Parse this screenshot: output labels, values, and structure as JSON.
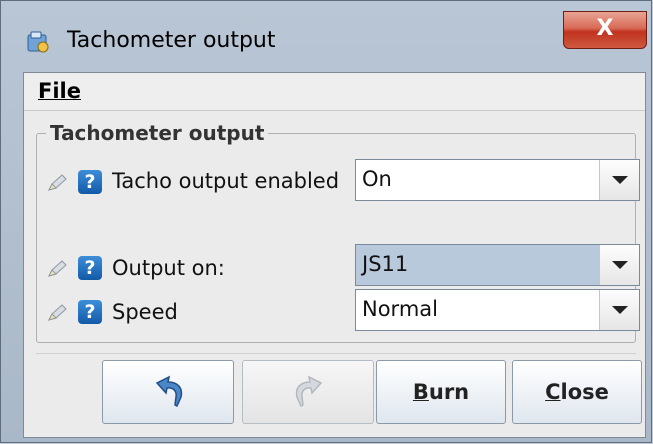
{
  "window": {
    "title": "Tachometer output",
    "close_glyph": "X"
  },
  "menubar": {
    "file_label": "File"
  },
  "group": {
    "title": "Tachometer output",
    "rows": [
      {
        "icon_edit": "pencil-icon",
        "icon_help": "help-icon",
        "help_glyph": "?",
        "label": "Tacho output enabled",
        "value": "On"
      },
      {
        "icon_edit": "pencil-icon",
        "icon_help": "help-icon",
        "help_glyph": "?",
        "label": "Output on:",
        "value": "JS11"
      },
      {
        "icon_edit": "pencil-icon",
        "icon_help": "help-icon",
        "help_glyph": "?",
        "label": "Speed",
        "value": "Normal"
      }
    ]
  },
  "buttons": {
    "undo_icon": "undo-icon",
    "redo_icon": "redo-icon",
    "burn_label_mnemonic": "B",
    "burn_label_rest": "urn",
    "close_label_mnemonic": "C",
    "close_label_rest": "lose"
  },
  "colors": {
    "help_blue": "#1f6fc0",
    "close_red": "#c8402c",
    "selected_combo": "#b9c9dc"
  }
}
